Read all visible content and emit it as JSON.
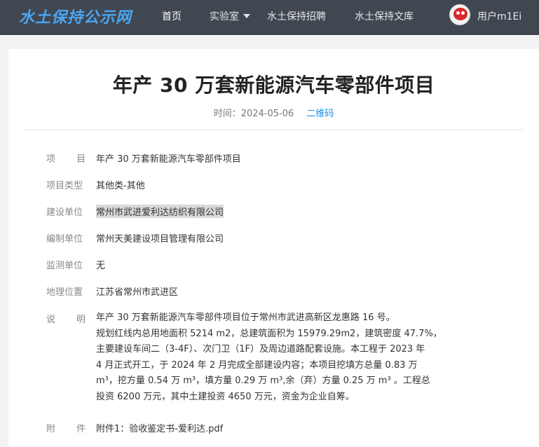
{
  "header": {
    "logo": "水土保持公示网",
    "nav": [
      {
        "label": "首页"
      },
      {
        "label": "实验室"
      },
      {
        "label": "水土保持招聘"
      },
      {
        "label": "水土保持文库"
      }
    ],
    "user": "用户m1Ei"
  },
  "article": {
    "title": "年产 30 万套新能源汽车零部件项目",
    "time_label": "时间：2024-05-06",
    "qr_label": "二维码",
    "fields": [
      {
        "label_a": "项",
        "label_b": "目",
        "value": "年产 30 万套新能源汽车零部件项目"
      },
      {
        "label": "项目类型",
        "value": "其他类-其他"
      },
      {
        "label": "建设单位",
        "value": "常州市武进爱利达纺织有限公司"
      },
      {
        "label": "编制单位",
        "value": "常州天美建设项目管理有限公司"
      },
      {
        "label": "监测单位",
        "value": "无"
      },
      {
        "label": "地理位置",
        "value": "江苏省常州市武进区"
      }
    ],
    "desc_label_a": "说",
    "desc_label_b": "明",
    "description_lines": [
      "年产 30 万套新能源汽车零部件项目位于常州市武进高新区龙惠路 16 号。",
      "规划红线内总用地面积 5214 m2，总建筑面积为 15979.29m2，建筑密度 47.7%，",
      "主要建设车间二（3-4F）、次门卫（1F）及周边道路配套设施。本工程于 2023 年",
      "4 月正式开工，于 2024 年 2 月完成全部建设内容；本项目挖填方总量 0.83 万",
      "m³，挖方量 0.54 万 m³，填方量 0.29 万 m³,余（弃）方量 0.25 万 m³ 。工程总",
      "投资 6200 万元，其中土建投资 4650 万元，资金为企业自筹。"
    ],
    "attach_label_a": "附",
    "attach_label_b": "件",
    "attachment": "附件1：验收鉴定书-爱利达.pdf"
  }
}
